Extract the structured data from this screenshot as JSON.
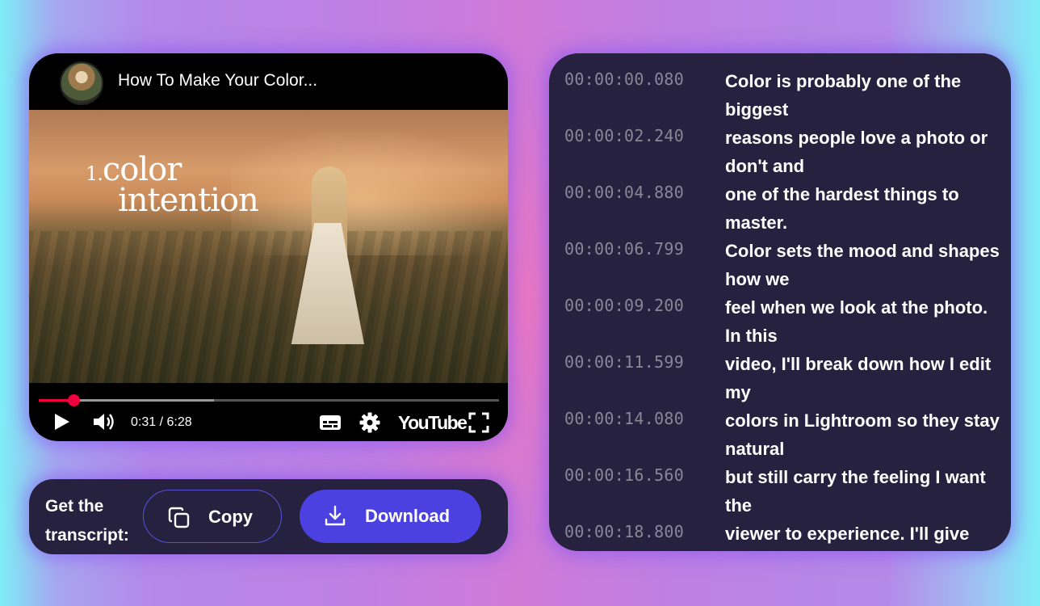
{
  "video": {
    "title": "How To Make Your Color...",
    "overlay_number": "1.",
    "overlay_line1": "color",
    "overlay_line2": "intention",
    "time_display": "0:31 / 6:28",
    "progress_fraction": 0.076,
    "buffered_fraction": 0.38,
    "logo_text": "YouTube",
    "icons": [
      "channel-avatar",
      "play-icon",
      "volume-icon",
      "captions-icon",
      "gear-icon",
      "fullscreen-icon"
    ],
    "accent_color": "#f0003c"
  },
  "actions": {
    "label": "Get the transcript:",
    "copy_label": "Copy",
    "download_label": "Download",
    "download_color": "#4b41e1"
  },
  "transcript": [
    {
      "time": "00:00:00.080",
      "text": "Color is probably one of the biggest"
    },
    {
      "time": "00:00:02.240",
      "text": "reasons people love a photo or don't and"
    },
    {
      "time": "00:00:04.880",
      "text": "one of the hardest things to master."
    },
    {
      "time": "00:00:06.799",
      "text": "Color sets the mood and shapes how we"
    },
    {
      "time": "00:00:09.200",
      "text": "feel when we look at the photo. In this"
    },
    {
      "time": "00:00:11.599",
      "text": "video, I'll break down how I edit my"
    },
    {
      "time": "00:00:14.080",
      "text": "colors in Lightroom so they stay natural"
    },
    {
      "time": "00:00:16.560",
      "text": "but still carry the feeling I want the"
    },
    {
      "time": "00:00:18.800",
      "text": "viewer to experience. I'll give"
    }
  ]
}
